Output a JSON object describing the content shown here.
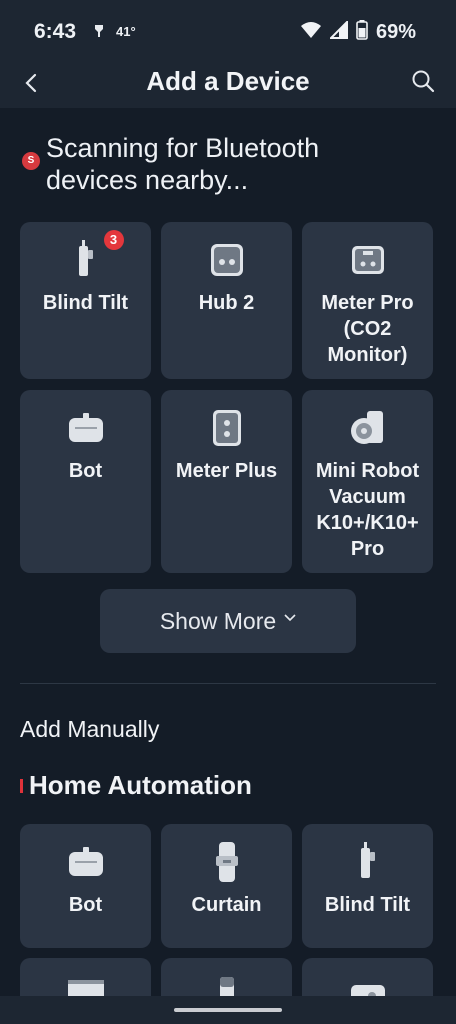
{
  "status": {
    "time": "6:43",
    "temperature": "41°",
    "battery": "69%"
  },
  "header": {
    "title": "Add a Device"
  },
  "scan": {
    "dot_label": "S",
    "text_line1": "Scanning for Bluetooth",
    "text_line2": "devices nearby..."
  },
  "nearby_devices": [
    {
      "label": "Blind Tilt",
      "badge": "3"
    },
    {
      "label": "Hub 2"
    },
    {
      "label": "Meter Pro (CO2 Monitor)"
    },
    {
      "label": "Bot"
    },
    {
      "label": "Meter Plus"
    },
    {
      "label": "Mini Robot Vacuum K10+/K10+ Pro"
    }
  ],
  "show_more": {
    "label": "Show More"
  },
  "add_manually": {
    "title": "Add Manually"
  },
  "home_automation": {
    "title": "Home Automation",
    "items": [
      {
        "label": "Bot"
      },
      {
        "label": "Curtain"
      },
      {
        "label": "Blind Tilt"
      }
    ]
  },
  "icons": {
    "back": "back-arrow-icon",
    "search": "search-icon",
    "wifi": "wifi-icon",
    "signal": "signal-icon",
    "battery": "battery-icon",
    "chevron": "chevron-down-icon"
  },
  "colors": {
    "background": "#141c27",
    "card": "#2b3544",
    "accent_red": "#e4373c"
  }
}
